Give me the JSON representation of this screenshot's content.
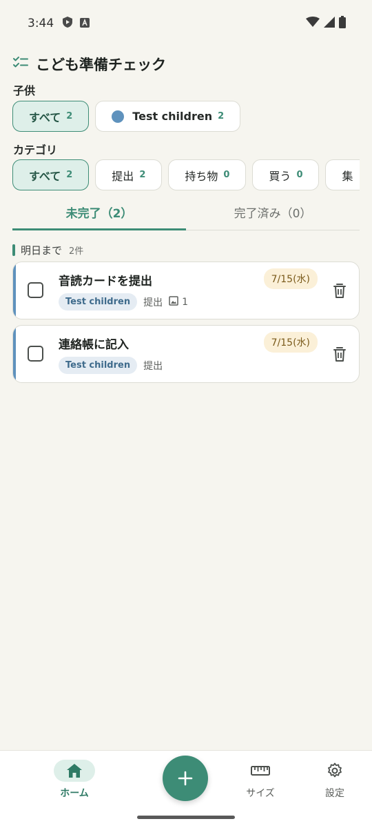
{
  "status_bar": {
    "time": "3:44"
  },
  "app": {
    "title": "こども準備チェック",
    "icon": "checklist-icon"
  },
  "children_filter": {
    "label": "子供",
    "chips": [
      {
        "label": "すべて",
        "count": "2",
        "selected": true
      },
      {
        "label": "Test children",
        "count": "2",
        "selected": false,
        "color": "#5f92bd"
      }
    ]
  },
  "category_filter": {
    "label": "カテゴリ",
    "chips": [
      {
        "label": "すべて",
        "count": "2",
        "selected": true
      },
      {
        "label": "提出",
        "count": "2",
        "selected": false
      },
      {
        "label": "持ち物",
        "count": "0",
        "selected": false
      },
      {
        "label": "買う",
        "count": "0",
        "selected": false
      },
      {
        "label": "集",
        "count": "",
        "selected": false
      }
    ]
  },
  "tabs": [
    {
      "label": "未完了（2）",
      "active": true
    },
    {
      "label": "完了済み（0）",
      "active": false
    }
  ],
  "group": {
    "title": "明日まで",
    "count": "2件"
  },
  "tasks": [
    {
      "title": "音読カードを提出",
      "child": "Test children",
      "category": "提出",
      "date": "7/15(水)",
      "photos": "1"
    },
    {
      "title": "連絡帳に記入",
      "child": "Test children",
      "category": "提出",
      "date": "7/15(水)"
    }
  ],
  "bottom_nav": {
    "items": [
      {
        "label": "ホーム",
        "icon": "home-icon",
        "active": true
      },
      {
        "label": "サイズ",
        "icon": "ruler-icon",
        "active": false
      },
      {
        "label": "設定",
        "icon": "gear-icon",
        "active": false
      }
    ],
    "fab_icon": "plus-icon"
  },
  "colors": {
    "accent": "#3d8c76",
    "child_color": "#5f92bd",
    "background": "#f6f5ef",
    "date_badge": "#fbf0d8"
  }
}
